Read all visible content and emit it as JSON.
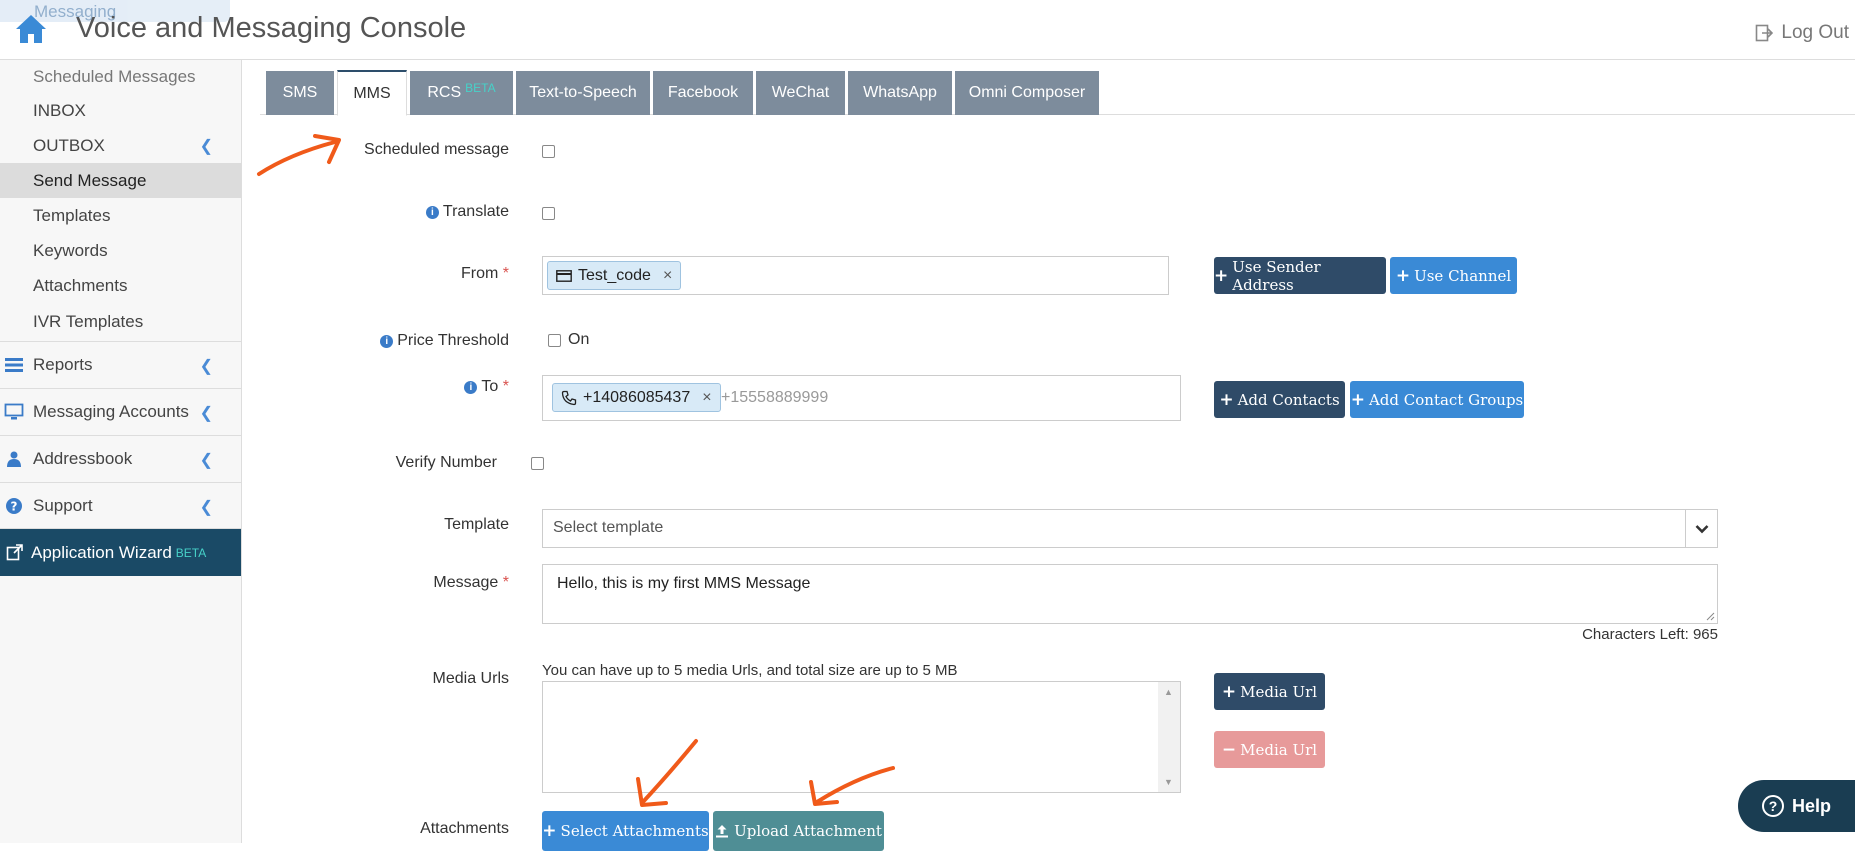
{
  "header": {
    "faded_label": "Messaging",
    "title": "Voice and Messaging Console",
    "logout_label": "Log Out"
  },
  "sidebar": {
    "items": [
      {
        "label": "Scheduled Messages"
      },
      {
        "label": "INBOX"
      },
      {
        "label": "OUTBOX"
      },
      {
        "label": "Send Message"
      },
      {
        "label": "Templates"
      },
      {
        "label": "Keywords"
      },
      {
        "label": "Attachments"
      },
      {
        "label": "IVR Templates"
      }
    ],
    "sections": [
      {
        "label": "Reports"
      },
      {
        "label": "Messaging Accounts"
      },
      {
        "label": "Addressbook"
      },
      {
        "label": "Support"
      }
    ],
    "wizard": {
      "label": "Application Wizard",
      "badge": "BETA"
    }
  },
  "tabs": [
    {
      "label": "SMS"
    },
    {
      "label": "MMS"
    },
    {
      "label": "RCS",
      "badge": "BETA"
    },
    {
      "label": "Text-to-Speech"
    },
    {
      "label": "Facebook"
    },
    {
      "label": "WeChat"
    },
    {
      "label": "WhatsApp"
    },
    {
      "label": "Omni Composer"
    }
  ],
  "form": {
    "scheduled_label": "Scheduled message",
    "translate_label": "Translate",
    "from_label": "From",
    "from_tag": "Test_code",
    "use_sender_label": "Use Sender Address",
    "use_channel_label": "Use Channel",
    "price_label": "Price Threshold",
    "price_on_label": "On",
    "to_label": "To",
    "to_tag": "+14086085437",
    "to_placeholder": "+15558889999",
    "add_contacts_label": "Add Contacts",
    "add_groups_label": "Add Contact Groups",
    "verify_label": "Verify Number",
    "template_label": "Template",
    "template_placeholder": "Select template",
    "message_label": "Message",
    "message_value": "Hello, this is my first MMS Message",
    "chars_left": "Characters Left: 965",
    "media_label": "Media Urls",
    "media_hint": "You can have up to 5 media Urls, and total size are up to 5 MB",
    "media_add_label": "Media Url",
    "media_remove_label": "Media Url",
    "attachments_label": "Attachments",
    "select_attach_label": "Select Attachments",
    "upload_attach_label": "Upload Attachment",
    "required_mark": "*"
  },
  "help": {
    "label": "Help"
  },
  "colors": {
    "accent_dark": "#2f4b68",
    "accent_blue": "#3a8ad6",
    "annotation": "#f05a1a",
    "wizard_bg": "#1a4a66"
  }
}
